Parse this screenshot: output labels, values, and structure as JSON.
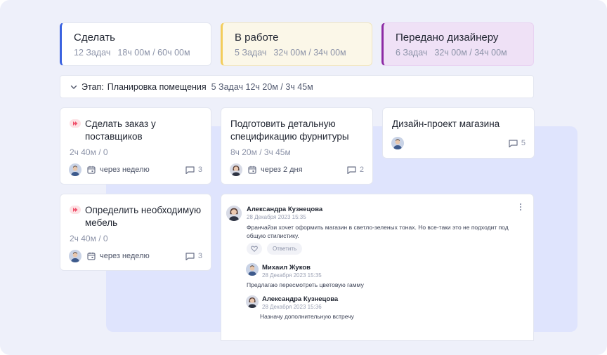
{
  "columns": [
    {
      "title": "Сделать",
      "tasks": "12 Задач",
      "time": "18ч 00м / 60ч 00м",
      "accent": "#3b63e0"
    },
    {
      "title": "В работе",
      "tasks": "5 Задач",
      "time": "32ч 00м / 34ч 00м",
      "accent": "#f3cd5a"
    },
    {
      "title": "Передано дизайнеру",
      "tasks": "6 Задач",
      "time": "32ч 00м / 34ч 00м",
      "accent": "#8c2aa4"
    }
  ],
  "stage": {
    "label": "Этап:",
    "name": "Планировка помещения",
    "meta": "5 Задач 12ч 20м / 3ч 45м"
  },
  "cards": [
    {
      "title": "Сделать заказ у поставщиков",
      "time": "2ч 40м / 0",
      "due": "через неделю",
      "comments": "3",
      "priority": true
    },
    {
      "title": "Подготовить детальную спецификацию фурнитуры",
      "time": "8ч 20м / 3ч 45м",
      "due": "через 2 дня",
      "comments": "2",
      "priority": false
    },
    {
      "title": "Дизайн-проект магазина",
      "comments": "5",
      "priority": false
    },
    {
      "title": "Определить необходимую мебель",
      "time": "2ч 40м / 0",
      "due": "через неделю",
      "comments": "3",
      "priority": true
    }
  ],
  "comment_thread": {
    "main": {
      "author": "Александра Кузнецова",
      "date": "28 Декабря 2023 15:35",
      "text": "Франчайзи хочет оформить магазин в светло-зеленых тонах. Но все-таки это не подходит под общую стилистику.",
      "reply_label": "Ответить"
    },
    "replies": [
      {
        "author": "Михаил Жуков",
        "date": "28 Декабря 2023 15:35",
        "text": "Предлагаю пересмотреть цветовую гамму"
      },
      {
        "author": "Александра Кузнецова",
        "date": "28 Декабря 2023 15:36",
        "text": "Назначу дополнительную встречу"
      }
    ]
  },
  "icons": {
    "priority": "priority-flag-icon",
    "calendar": "calendar-icon",
    "comment": "comment-icon",
    "chevron": "chevron-down-icon",
    "like": "heart-icon",
    "more": "more-vertical-icon"
  }
}
